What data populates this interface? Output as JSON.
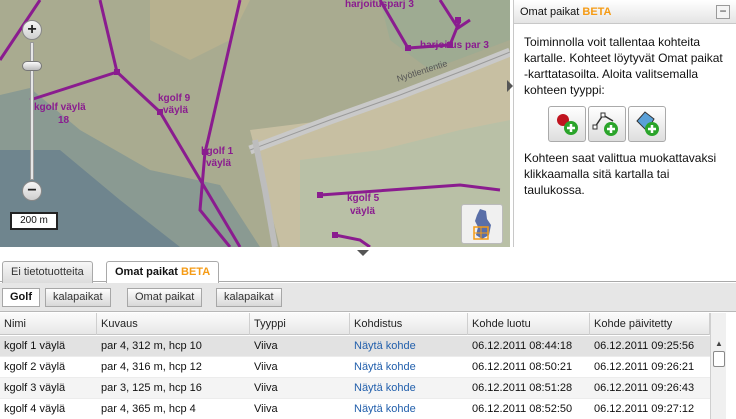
{
  "map": {
    "zoom_in": "+",
    "zoom_out": "−",
    "scale": "200 m",
    "labels": [
      "harjoitusparj 3",
      "harjoitus par 3",
      "Nyötlententie",
      "kgolf väylä",
      "18",
      "kgolf 9",
      "väylä",
      "kgolf 1",
      "väylä",
      "kgolf 5",
      "väylä"
    ],
    "route_color": "#8a1c8f"
  },
  "side_panel": {
    "title": "Omat paikat",
    "beta": "BETA",
    "minimize": "−",
    "intro": "Toiminnolla voit tallentaa kohteita kartalle. Kohteet löytyvät Omat paikat -karttatasoilta. Aloita valitsemalla kohteen tyyppi:",
    "tools": [
      "add-point",
      "add-line",
      "add-area"
    ],
    "outro": "Kohteen saat valittua muokattavaksi klikkaamalla sitä kartalla tai taulukossa."
  },
  "tabs": {
    "ei_tietotuotteita": "Ei tietotuotteita",
    "omat_paikat": "Omat paikat",
    "beta": "BETA"
  },
  "subtabs": [
    "Golf",
    "kalapaikat",
    "Omat paikat",
    "kalapaikat"
  ],
  "grid": {
    "columns": [
      "Nimi",
      "Kuvaus",
      "Tyyppi",
      "Kohdistus",
      "Kohde luotu",
      "Kohde päivitetty"
    ],
    "rows": [
      [
        "kgolf 1 väylä",
        "par 4, 312 m, hcp 10",
        "Viiva",
        "Näytä kohde",
        "06.12.2011 08:44:18",
        "06.12.2011 09:25:56"
      ],
      [
        "kgolf 2 väylä",
        "par 4, 316 m, hcp 12",
        "Viiva",
        "Näytä kohde",
        "06.12.2011 08:50:21",
        "06.12.2011 09:26:21"
      ],
      [
        "kgolf 3 väylä",
        "par 3, 125 m, hcp 16",
        "Viiva",
        "Näytä kohde",
        "06.12.2011 08:51:28",
        "06.12.2011 09:26:43"
      ],
      [
        "kgolf 4 väylä",
        "par 4, 365 m, hcp 4",
        "Viiva",
        "Näytä kohde",
        "06.12.2011 08:52:50",
        "06.12.2011 09:27:12"
      ]
    ]
  }
}
